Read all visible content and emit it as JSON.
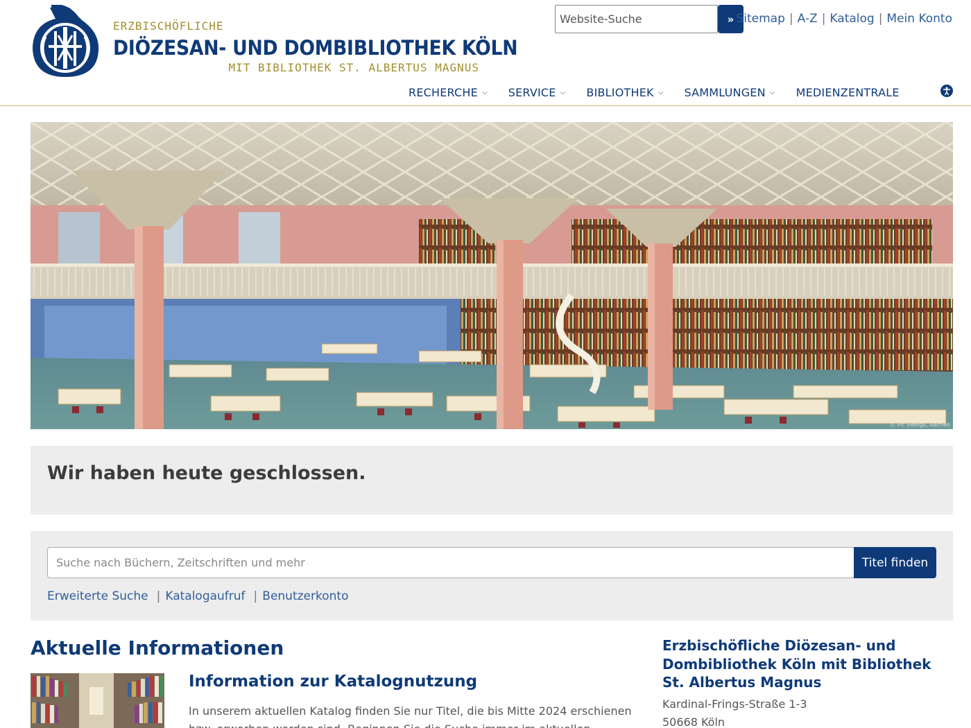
{
  "header": {
    "logo": {
      "line1": "ERZBISCHÖFLICHE",
      "line2": "DIÖZESAN- UND DOMBIBLIOTHEK KÖLN",
      "line3": "MIT BIBLIOTHEK ST. ALBERTUS MAGNUS"
    },
    "site_search": {
      "placeholder": "Website-Suche",
      "button": "»"
    },
    "toplinks": [
      "Sitemap",
      "A-Z",
      "Katalog",
      "Mein Konto"
    ],
    "nav": [
      {
        "label": "RECHERCHE",
        "dropdown": true
      },
      {
        "label": "SERVICE",
        "dropdown": true
      },
      {
        "label": "BIBLIOTHEK",
        "dropdown": true
      },
      {
        "label": "SAMMLUNGEN",
        "dropdown": true
      },
      {
        "label": "MEDIENZENTRALE",
        "dropdown": false
      }
    ],
    "accessibility_icon": "accessibility-icon"
  },
  "hero": {
    "credit": "© Pit Siebigs, Aachen"
  },
  "notice": {
    "text": "Wir haben heute geschlossen."
  },
  "catalog_search": {
    "placeholder": "Suche nach Büchern, Zeitschriften und mehr",
    "button": "Titel finden",
    "links": [
      "Erweiterte Suche",
      "Katalogaufruf",
      "Benutzerkonto"
    ]
  },
  "news": {
    "section_title": "Aktuelle Informationen",
    "item": {
      "title": "Information zur Katalognutzung",
      "text": "In unserem aktuellen Katalog finden Sie nur Titel, die bis Mitte 2024 erschienen bzw. erworben worden sind. Beginnen Sie die Suche immer im aktuellen Katalog."
    }
  },
  "address": {
    "title": "Erzbischöfliche Diözesan- und Dombibliothek Köln mit Bibliothek St. Albertus Magnus",
    "street": "Kardinal-Frings-Straße 1-3",
    "city": "50668 Köln"
  },
  "colors": {
    "brand_blue": "#0f3a78",
    "gold": "#a48f2d",
    "link_blue": "#2f5e99"
  }
}
